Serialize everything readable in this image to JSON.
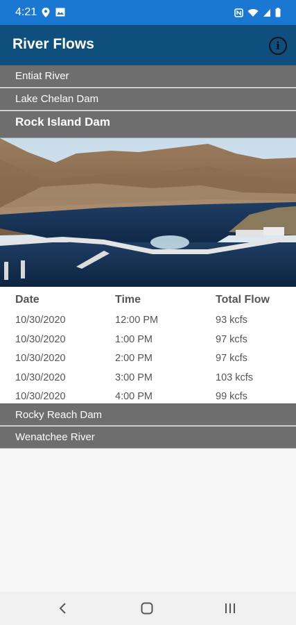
{
  "status": {
    "time": "4:21"
  },
  "app": {
    "title": "River Flows"
  },
  "sections_top": [
    {
      "label": "Entiat River"
    },
    {
      "label": "Lake Chelan Dam"
    },
    {
      "label": "Rock Island Dam"
    }
  ],
  "table": {
    "headers": [
      "Date",
      "Time",
      "Total Flow"
    ],
    "rows": [
      {
        "date": "10/30/2020",
        "time": "12:00 PM",
        "flow": "93 kcfs"
      },
      {
        "date": "10/30/2020",
        "time": "1:00 PM",
        "flow": "97 kcfs"
      },
      {
        "date": "10/30/2020",
        "time": "2:00 PM",
        "flow": "97 kcfs"
      },
      {
        "date": "10/30/2020",
        "time": "3:00 PM",
        "flow": "103 kcfs"
      },
      {
        "date": "10/30/2020",
        "time": "4:00 PM",
        "flow": "99 kcfs"
      }
    ]
  },
  "sections_bottom": [
    {
      "label": "Rocky Reach Dam"
    },
    {
      "label": "Wenatchee River"
    }
  ],
  "icons": {
    "status_left": [
      "location-pin-icon",
      "image-icon"
    ],
    "status_right": [
      "nfc-icon",
      "wifi-icon",
      "signal-icon",
      "battery-icon"
    ],
    "info": "info-icon",
    "nav": [
      "back-icon",
      "home-icon",
      "recents-icon"
    ]
  },
  "colors": {
    "status_bar": "#1a77d2",
    "app_bar": "#0f4f7d",
    "section_row": "#6e6e6e"
  }
}
